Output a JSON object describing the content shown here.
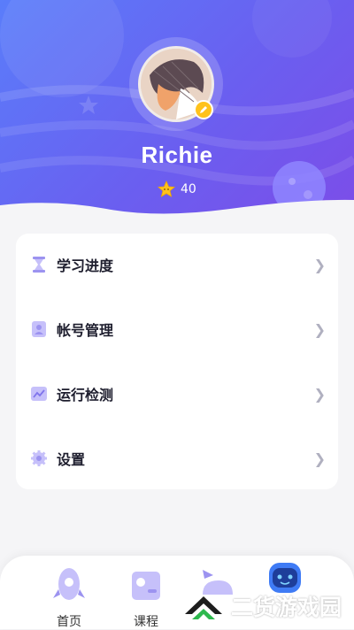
{
  "profile": {
    "name": "Richie",
    "stars": "40"
  },
  "menu": [
    {
      "label": "学习进度",
      "icon": "hourglass-icon"
    },
    {
      "label": "帐号管理",
      "icon": "account-icon"
    },
    {
      "label": "运行检测",
      "icon": "chart-line-icon"
    },
    {
      "label": "设置",
      "icon": "gear-icon"
    }
  ],
  "tabs": [
    {
      "label": "首页",
      "icon": "rocket-icon"
    },
    {
      "label": "课程",
      "icon": "course-icon"
    },
    {
      "label": "",
      "icon": "whale-icon"
    },
    {
      "label": "",
      "icon": "robot-icon"
    }
  ],
  "watermark": {
    "text": "二货游戏园"
  },
  "colors": {
    "accent": "#6a5ff0",
    "star": "#ffc21c",
    "icon": "#9c93f0"
  }
}
